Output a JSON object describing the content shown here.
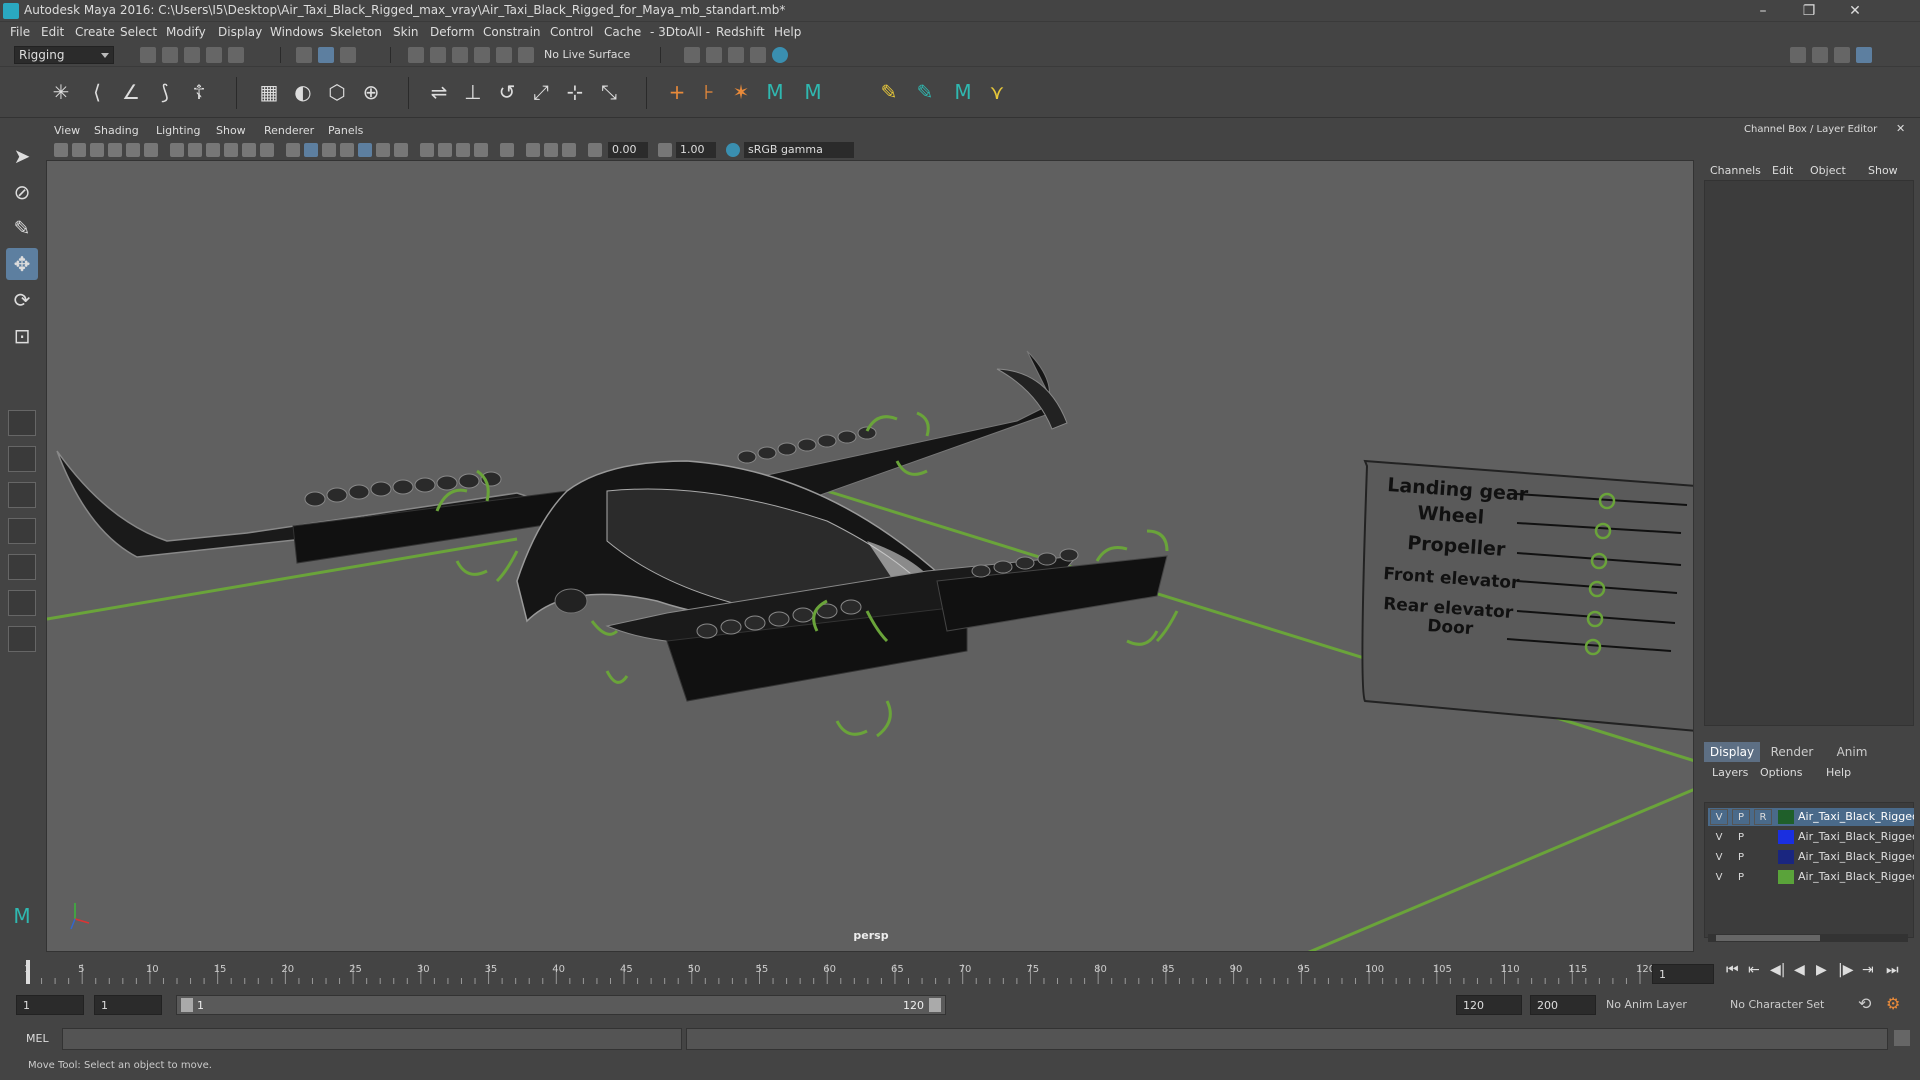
{
  "window": {
    "title": "Autodesk Maya 2016: C:\\Users\\I5\\Desktop\\Air_Taxi_Black_Rigged_max_vray\\Air_Taxi_Black_Rigged_for_Maya_mb_standart.mb*",
    "minimize": "–",
    "restore": "❐",
    "close": "✕"
  },
  "menubar": [
    "File",
    "Edit",
    "Create",
    "Select",
    "Modify",
    "Display",
    "Windows",
    "Skeleton",
    "Skin",
    "Deform",
    "Constrain",
    "Control",
    "Cache",
    "- 3DtoAll -",
    "Redshift",
    "Help"
  ],
  "statusline": {
    "mode": "Rigging",
    "live_surface": "No Live Surface"
  },
  "panel": {
    "menus": [
      "View",
      "Shading",
      "Lighting",
      "Show",
      "Renderer",
      "Panels"
    ],
    "exposure": "0.00",
    "gamma": "1.00",
    "color_space": "sRGB gamma",
    "camera_label": "persp"
  },
  "rig_ui": {
    "labels": [
      "Landing gear",
      "Wheel",
      "Propeller",
      "Front elevator",
      "Rear elevator",
      "Door"
    ]
  },
  "channelbox": {
    "title": "Channel Box / Layer Editor",
    "menus": [
      "Channels",
      "Edit",
      "Object",
      "Show"
    ],
    "tabs": [
      "Display",
      "Render",
      "Anim"
    ],
    "layer_menus": [
      "Layers",
      "Options",
      "Help"
    ],
    "layers": [
      {
        "v": "V",
        "p": "P",
        "r": "R",
        "color": "#1f5f2a",
        "name": "Air_Taxi_Black_Rigged",
        "selected": true
      },
      {
        "v": "V",
        "p": "P",
        "r": "",
        "color": "#1a2fe0",
        "name": "Air_Taxi_Black_Rigged_",
        "selected": false
      },
      {
        "v": "V",
        "p": "P",
        "r": "",
        "color": "#1a2680",
        "name": "Air_Taxi_Black_Rigged",
        "selected": false
      },
      {
        "v": "V",
        "p": "P",
        "r": "",
        "color": "#5aa33a",
        "name": "Air_Taxi_Black_Rigged_",
        "selected": false
      }
    ]
  },
  "timeslider": {
    "ticks": [
      "1",
      "5",
      "10",
      "15",
      "20",
      "25",
      "30",
      "35",
      "40",
      "45",
      "50",
      "55",
      "60",
      "65",
      "70",
      "75",
      "80",
      "85",
      "90",
      "95",
      "100",
      "105",
      "110",
      "115",
      "120"
    ],
    "current_frame": "1"
  },
  "range": {
    "start": "1",
    "anim_start": "1",
    "slider_start": "1",
    "slider_end": "120",
    "anim_end": "120",
    "end": "200",
    "anim_layer": "No Anim Layer",
    "character_set": "No Character Set"
  },
  "cmdline": {
    "label": "MEL"
  },
  "helpline": {
    "text": "Move Tool: Select an object to move."
  },
  "colors": {
    "accent": "#5d7fa0",
    "grid_green": "#6aa43a",
    "viewport_bg": "#606060"
  }
}
